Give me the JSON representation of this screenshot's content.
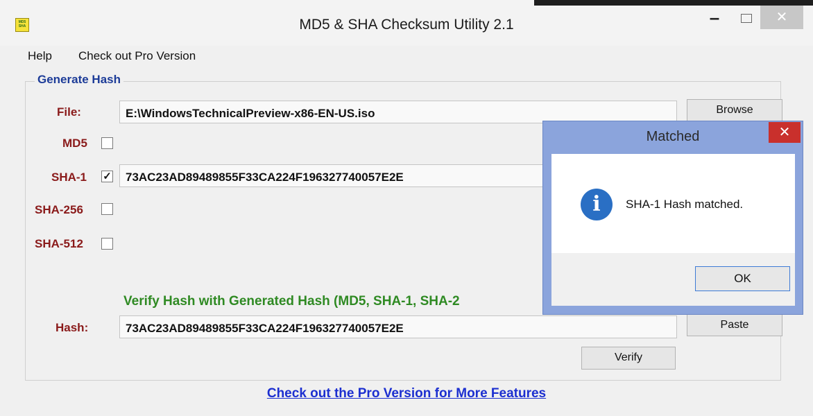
{
  "window": {
    "title": "MD5 & SHA Checksum Utility 2.1",
    "icon_text": "MD5 SHA",
    "minimize": "–",
    "close": "✕"
  },
  "menu": {
    "items": [
      "Help",
      "Check out Pro Version"
    ]
  },
  "generate": {
    "group_title": "Generate Hash",
    "file_label": "File:",
    "file_value": "E:\\WindowsTechnicalPreview-x86-EN-US.iso",
    "browse_label": "Browse",
    "md5_label": "MD5",
    "md5_checked": "",
    "sha1_label": "SHA-1",
    "sha1_checked": "✓",
    "sha1_value": "73AC23AD89489855F33CA224F196327740057E2E",
    "sha256_label": "SHA-256",
    "sha256_checked": "",
    "sha512_label": "SHA-512",
    "sha512_checked": ""
  },
  "verify": {
    "heading": "Verify Hash with Generated Hash (MD5, SHA-1, SHA-2",
    "hash_label": "Hash:",
    "hash_value": "73AC23AD89489855F33CA224F196327740057E2E",
    "paste_label": "Paste",
    "verify_label": "Verify"
  },
  "footer": {
    "pro_link": "Check out the Pro Version for More Features"
  },
  "dialog": {
    "title": "Matched",
    "close": "✕",
    "icon": "i",
    "message": "SHA-1 Hash matched.",
    "ok_label": "OK"
  }
}
